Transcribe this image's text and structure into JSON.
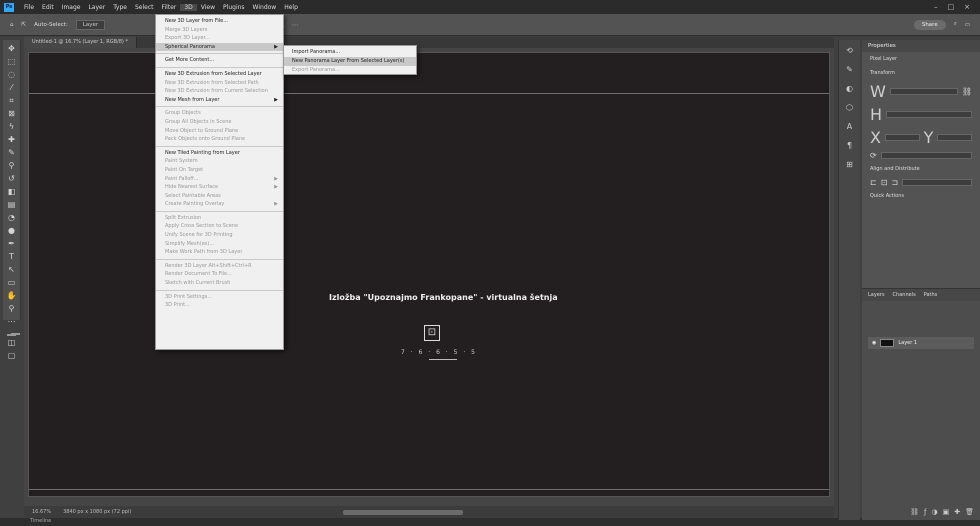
{
  "menubar": {
    "logo": "Ps",
    "items": [
      "File",
      "Edit",
      "Image",
      "Layer",
      "Type",
      "Select",
      "Filter",
      "3D",
      "View",
      "Plugins",
      "Window",
      "Help"
    ],
    "active_index": 7,
    "window_controls": [
      "–",
      "□",
      "×"
    ]
  },
  "optionsbar": {
    "home": "⌂",
    "tool": "⇱",
    "auto_select": "Auto-Select:",
    "auto_select_value": "Layer",
    "share_label": "Share",
    "search_icon": "search-icon"
  },
  "document": {
    "tab_title": "Untitled-1 @ 16.7% (Layer 1, RGB/8) *"
  },
  "canvas": {
    "title": "Izložba \"Upoznajmo Frankopane\" - virtualna šetnja",
    "icon_glyph": "⊡",
    "caption": "7 · 6 · 6 · 5 · 5"
  },
  "status": {
    "zoom": "16.67%",
    "doc_info": "3840 px x 1080 px (72 ppi)"
  },
  "bottom": {
    "label": "Timeline"
  },
  "menu3d": {
    "items": [
      {
        "label": "New 3D Layer from File...",
        "disabled": false,
        "arrow": false
      },
      {
        "label": "Merge 3D Layers",
        "disabled": true,
        "arrow": false
      },
      {
        "label": "Export 3D Layer...",
        "disabled": true,
        "arrow": false
      },
      {
        "label": "Spherical Panorama",
        "disabled": false,
        "arrow": true,
        "highlight": true
      },
      {
        "sep": true
      },
      {
        "label": "Get More Content...",
        "disabled": false,
        "arrow": false
      },
      {
        "sep": true
      },
      {
        "label": "New 3D Extrusion from Selected Layer",
        "disabled": false,
        "arrow": false
      },
      {
        "label": "New 3D Extrusion from Selected Path",
        "disabled": true,
        "arrow": false
      },
      {
        "label": "New 3D Extrusion from Current Selection",
        "disabled": true,
        "arrow": false
      },
      {
        "label": "New Mesh from Layer",
        "disabled": false,
        "arrow": true
      },
      {
        "sep": true
      },
      {
        "label": "Group Objects",
        "disabled": true,
        "arrow": false
      },
      {
        "label": "Group All Objects in Scene",
        "disabled": true,
        "arrow": false
      },
      {
        "label": "Move Object to Ground Plane",
        "disabled": true,
        "arrow": false
      },
      {
        "label": "Pack Objects onto Ground Plane",
        "disabled": true,
        "arrow": false
      },
      {
        "sep": true
      },
      {
        "label": "New Tiled Painting from Layer",
        "disabled": false,
        "arrow": false
      },
      {
        "label": "Paint System",
        "disabled": true,
        "arrow": false
      },
      {
        "label": "Paint On Target",
        "disabled": true,
        "arrow": false
      },
      {
        "label": "Paint Falloff...",
        "disabled": true,
        "arrow": true
      },
      {
        "label": "Hide Nearest Surface",
        "disabled": true,
        "arrow": true
      },
      {
        "label": "Select Paintable Areas",
        "disabled": true,
        "arrow": false
      },
      {
        "label": "Create Painting Overlay",
        "disabled": true,
        "arrow": true
      },
      {
        "sep": true
      },
      {
        "label": "Split Extrusion",
        "disabled": true,
        "arrow": false
      },
      {
        "label": "Apply Cross Section to Scene",
        "disabled": true,
        "arrow": false
      },
      {
        "label": "Unify Scene for 3D Printing",
        "disabled": true,
        "arrow": false
      },
      {
        "label": "Simplify Mesh(es)...",
        "disabled": true,
        "arrow": false
      },
      {
        "label": "Make Work Path from 3D Layer",
        "disabled": true,
        "arrow": false
      },
      {
        "sep": true
      },
      {
        "label": "Render 3D Layer          Alt+Shift+Ctrl+R",
        "disabled": true,
        "arrow": false
      },
      {
        "label": "Render Document To File...",
        "disabled": true,
        "arrow": false
      },
      {
        "label": "Sketch with Current Brush",
        "disabled": true,
        "arrow": false
      },
      {
        "sep": true
      },
      {
        "label": "3D Print Settings...",
        "disabled": true,
        "arrow": false
      },
      {
        "label": "3D Print...",
        "disabled": true,
        "arrow": false
      }
    ]
  },
  "submenu": {
    "items": [
      {
        "label": "Import Panorama...",
        "disabled": false
      },
      {
        "label": "New Panorama Layer From Selected Layer(s)",
        "disabled": false,
        "highlight": true
      },
      {
        "label": "Export Panorama...",
        "disabled": true
      }
    ]
  },
  "properties": {
    "tab": "Properties",
    "kind": "Pixel Layer",
    "transform": "Transform",
    "w": "W",
    "h": "H",
    "x": "X",
    "y": "Y",
    "align": "Align and Distribute",
    "quick_actions": "Quick Actions"
  },
  "layers": {
    "tabs": [
      "Layers",
      "Channels",
      "Paths"
    ],
    "layer_name": "Layer 1"
  }
}
